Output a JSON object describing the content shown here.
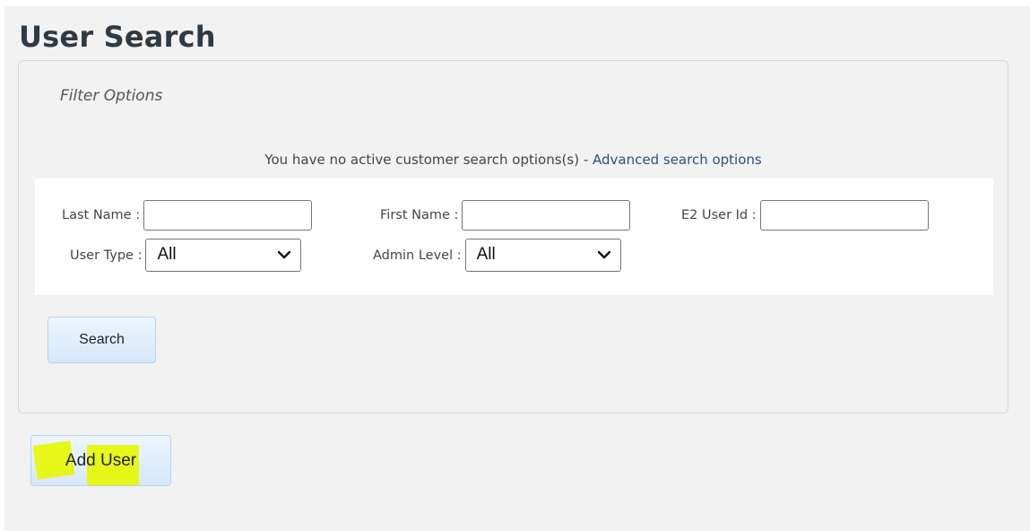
{
  "page": {
    "title": "User Search"
  },
  "filter": {
    "legend": "Filter Options",
    "notice_text": "You have no active customer search options(s) -",
    "advanced_link": "Advanced search options"
  },
  "fields": {
    "last_name": {
      "label": "Last Name :",
      "value": ""
    },
    "first_name": {
      "label": "First Name :",
      "value": ""
    },
    "e2_user_id": {
      "label": "E2 User Id :",
      "value": ""
    },
    "user_type": {
      "label": "User Type :",
      "selected": "All"
    },
    "admin_level": {
      "label": "Admin Level :",
      "selected": "All"
    }
  },
  "buttons": {
    "search": "Search",
    "add_user": "Add User"
  },
  "colors": {
    "title": "#2e3a44",
    "link": "#2e4f86",
    "button_bg": "#d6e7fa",
    "highlight": "#e8f700"
  },
  "icons": {
    "select_arrow": "chevron-down-icon"
  }
}
